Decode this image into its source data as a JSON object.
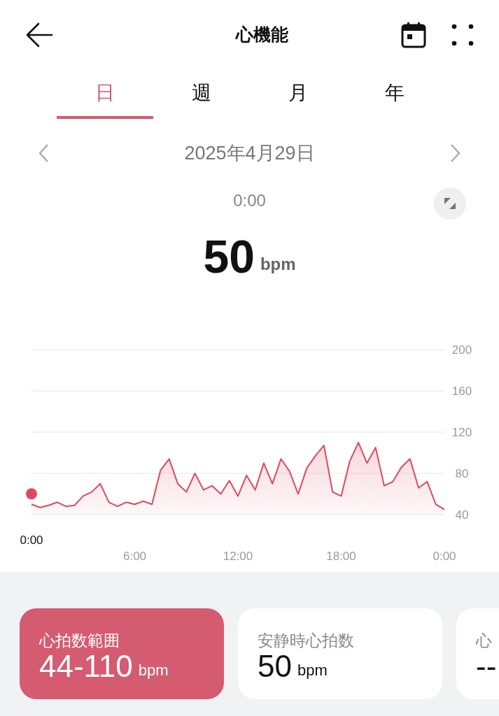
{
  "header": {
    "title": "心機能"
  },
  "tabs": [
    {
      "label": "日",
      "selected": true
    },
    {
      "label": "週",
      "selected": false
    },
    {
      "label": "月",
      "selected": false
    },
    {
      "label": "年",
      "selected": false
    }
  ],
  "date": "2025年4月29日",
  "selected_time": "0:00",
  "reading": {
    "value": "50",
    "unit": "bpm"
  },
  "chart_data": {
    "type": "area",
    "xlim": [
      0,
      24
    ],
    "ylim": [
      40,
      200
    ],
    "yticks": [
      40,
      80,
      120,
      160,
      200
    ],
    "xticks": [
      {
        "value": 6,
        "label": "6:00"
      },
      {
        "value": 12,
        "label": "12:00"
      },
      {
        "value": 18,
        "label": "18:00"
      },
      {
        "value": 24,
        "label": "0:00"
      }
    ],
    "x": [
      0,
      0.5,
      1,
      1.5,
      2,
      2.5,
      3,
      3.5,
      4,
      4.5,
      5,
      5.5,
      6,
      6.5,
      7,
      7.5,
      8,
      8.5,
      9,
      9.5,
      10,
      10.5,
      11,
      11.5,
      12,
      12.5,
      13,
      13.5,
      14,
      14.5,
      15,
      15.5,
      16,
      16.5,
      17,
      17.5,
      18,
      18.5,
      19,
      19.5,
      20,
      20.5,
      21,
      21.5,
      22,
      22.5,
      23,
      23.5,
      24
    ],
    "series": [
      {
        "color": "#e0485f",
        "values": [
          50,
          47,
          49,
          52,
          48,
          49,
          58,
          62,
          70,
          52,
          48,
          52,
          50,
          53,
          50,
          83,
          94,
          70,
          62,
          80,
          64,
          68,
          60,
          73,
          58,
          78,
          64,
          90,
          70,
          94,
          82,
          60,
          85,
          97,
          107,
          62,
          58,
          92,
          110,
          90,
          105,
          68,
          72,
          86,
          94,
          66,
          72,
          50,
          45
        ]
      }
    ],
    "grid": true
  },
  "cursor_label": "0:00",
  "cards": [
    {
      "label": "心拍数範囲",
      "value": "44-110",
      "unit": "bpm",
      "selected": true
    },
    {
      "label": "安静時心拍数",
      "value": "50",
      "unit": "bpm",
      "selected": false
    },
    {
      "label": "心",
      "value": "--",
      "selected": false
    }
  ]
}
